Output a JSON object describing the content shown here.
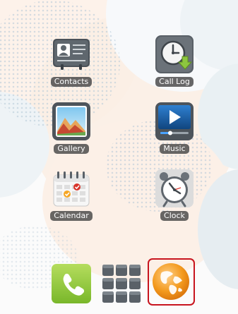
{
  "apps": [
    {
      "label": "Contacts",
      "icon": "contacts-icon"
    },
    {
      "label": "Call Log",
      "icon": "call-log-icon"
    },
    {
      "label": "Gallery",
      "icon": "gallery-icon"
    },
    {
      "label": "Music",
      "icon": "music-icon"
    },
    {
      "label": "Calendar",
      "icon": "calendar-icon"
    },
    {
      "label": "Clock",
      "icon": "clock-icon"
    }
  ],
  "dock": {
    "items": [
      {
        "icon": "phone-icon"
      },
      {
        "icon": "app-drawer-icon"
      },
      {
        "icon": "browser-globe-icon",
        "selected": true
      }
    ]
  },
  "colors": {
    "highlight": "#c8141e",
    "label_bg": "#464646",
    "phone_green": "#8dc63f",
    "globe_orange": "#f39a1e"
  }
}
